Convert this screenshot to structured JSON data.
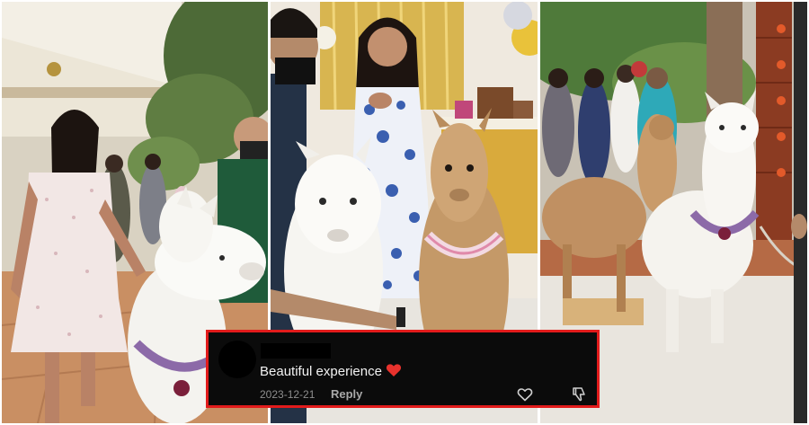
{
  "comment": {
    "text": "Beautiful experience",
    "emoji": "heart",
    "date": "2023-12-21",
    "reply_label": "Reply",
    "like_icon": "heart-outline-icon",
    "dislike_icon": "thumbs-down-icon"
  },
  "colors": {
    "highlight_border": "#e21b1b",
    "comment_background": "#0b0b0b",
    "emoji_heart": "#e8322d"
  }
}
